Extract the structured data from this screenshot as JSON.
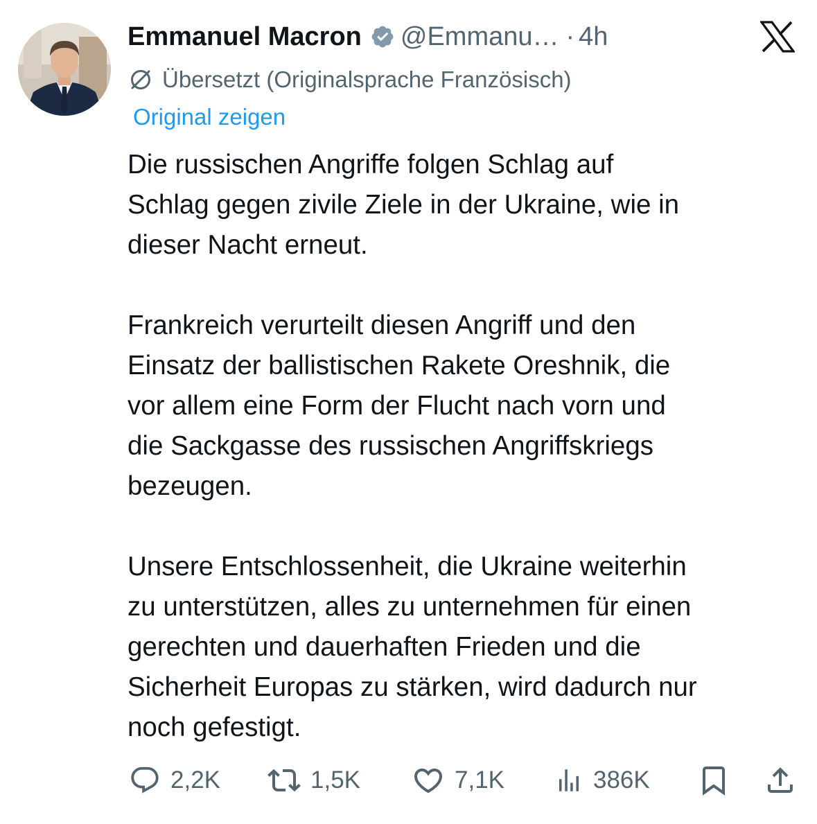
{
  "tweet": {
    "author": {
      "display_name": "Emmanuel Macron",
      "handle": "@Emmanu…",
      "verified": true,
      "avatar_icon": "profile-photo"
    },
    "separator": "·",
    "time": "4h",
    "platform_icon": "x-logo-icon",
    "translation": {
      "label": "Übersetzt (Originalsprache Französisch)",
      "show_original_link": "Original zeigen"
    },
    "paragraphs": [
      "Die russischen Angriffe folgen Schlag auf\nSchlag gegen zivile Ziele in der Ukraine, wie in\ndieser Nacht erneut.",
      "Frankreich verurteilt diesen Angriff und den\nEinsatz der ballistischen Rakete Oreshnik, die\nvor allem eine Form der Flucht nach vorn und\ndie Sackgasse des russischen Angriffskriegs\nbezeugen.",
      "Unsere Entschlossenheit, die Ukraine weiterhin\nzu unterstützen, alles zu unternehmen für einen\ngerechten und dauerhaften Frieden und die\nSicherheit Europas zu stärken, wird dadurch nur\nnoch gefestigt."
    ],
    "actions": {
      "replies": "2,2K",
      "reposts": "1,5K",
      "likes": "7,1K",
      "views": "386K"
    }
  },
  "colors": {
    "text_primary": "#0f1419",
    "text_secondary": "#536471",
    "link": "#1d9bf0",
    "verified_badge": "#829aab"
  }
}
